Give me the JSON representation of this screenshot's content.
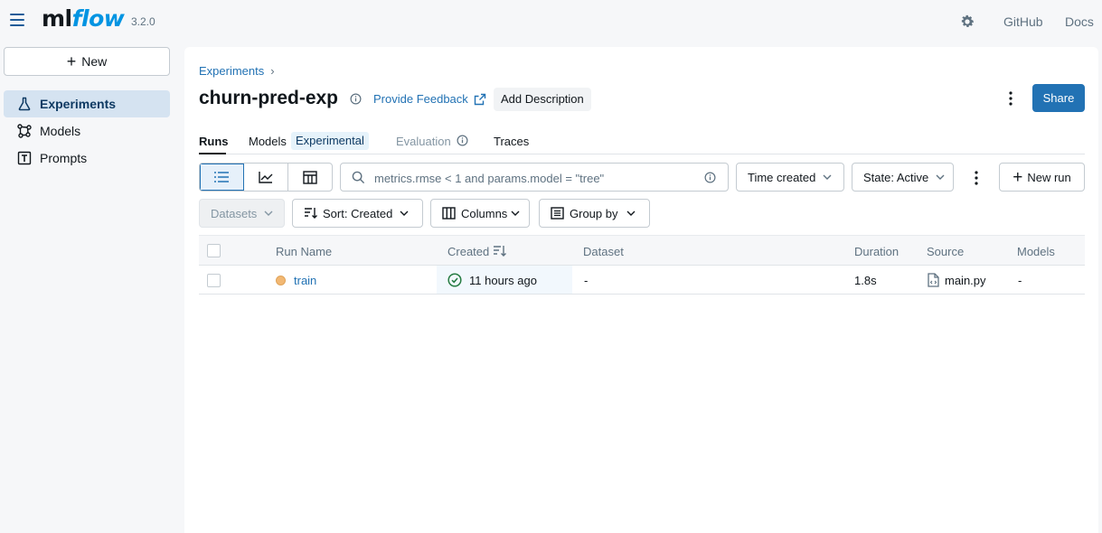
{
  "app": {
    "logo_ml": "ml",
    "logo_flow": "flow",
    "version": "3.2.0"
  },
  "topnav": {
    "github": "GitHub",
    "docs": "Docs"
  },
  "sidebar": {
    "new_label": "New",
    "items": [
      {
        "label": "Experiments",
        "active": true
      },
      {
        "label": "Models"
      },
      {
        "label": "Prompts"
      }
    ]
  },
  "header": {
    "breadcrumb": "Experiments",
    "breadcrumb_sep": "›",
    "title": "churn-pred-exp",
    "feedback": "Provide Feedback",
    "add_description": "Add Description",
    "share": "Share"
  },
  "tabs": [
    {
      "label": "Runs",
      "active": true
    },
    {
      "label": "Models"
    },
    {
      "label": "Evaluation"
    },
    {
      "label": "Traces"
    }
  ],
  "tab_badge": "Experimental",
  "toolbar": {
    "search_placeholder": "metrics.rmse < 1 and params.model = \"tree\"",
    "time_filter": "Time created",
    "state_filter": "State: Active",
    "new_run": "New run",
    "datasets": "Datasets",
    "sort": "Sort: Created",
    "columns": "Columns",
    "group_by": "Group by"
  },
  "table": {
    "headers": [
      "Run Name",
      "Created",
      "Dataset",
      "Duration",
      "Source",
      "Models"
    ],
    "rows": [
      {
        "run_name": "train",
        "created": "11 hours ago",
        "dataset": "-",
        "duration": "1.8s",
        "source": "main.py",
        "models": "-"
      }
    ]
  },
  "colors": {
    "accent": "#2272b4",
    "active_nav_bg": "#d5e3f1",
    "status_dot": "#f2b873",
    "success": "#277c43"
  }
}
